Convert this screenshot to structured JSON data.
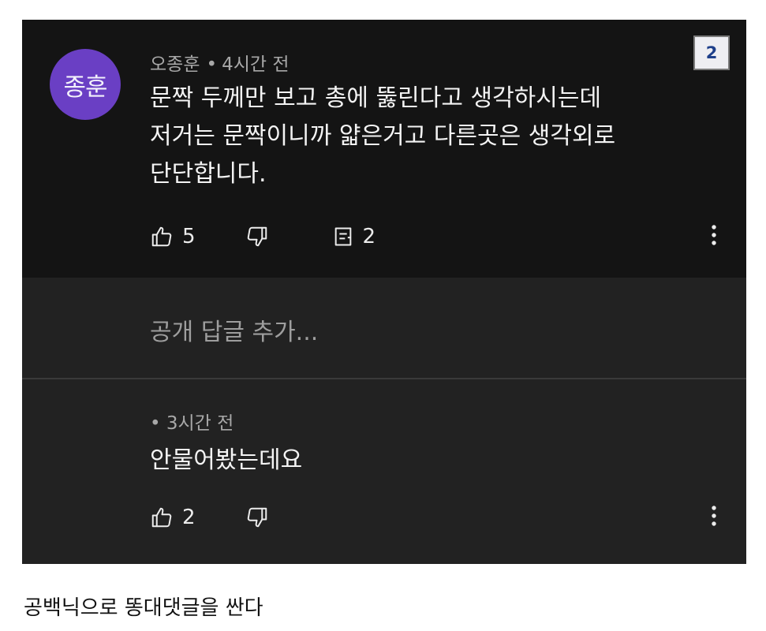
{
  "comment": {
    "avatar_text": "종훈",
    "author": "오종훈",
    "separator": "•",
    "time": "4시간 전",
    "text": "문짝 두께만 보고 총에 뚫린다고 생각하시는데\n저거는 문짝이니까 얇은거고 다른곳은 생각외로\n단단합니다.",
    "likes": "5",
    "replies_count": "2",
    "badge": "2"
  },
  "reply_input": {
    "placeholder": "공개 답글 추가..."
  },
  "reply": {
    "separator": "•",
    "time": "3시간 전",
    "text": "안물어봤는데요",
    "likes": "2"
  },
  "caption": "공백닉으로 똥대댓글을 싼다",
  "colors": {
    "avatar": "#6a3fc4",
    "comment_background": "#141414",
    "reply_background": "#222222",
    "badge_text": "#1e3f8a"
  },
  "icons": [
    "thumbs-up-icon",
    "thumbs-down-icon",
    "reply-icon",
    "more-vertical-icon"
  ]
}
